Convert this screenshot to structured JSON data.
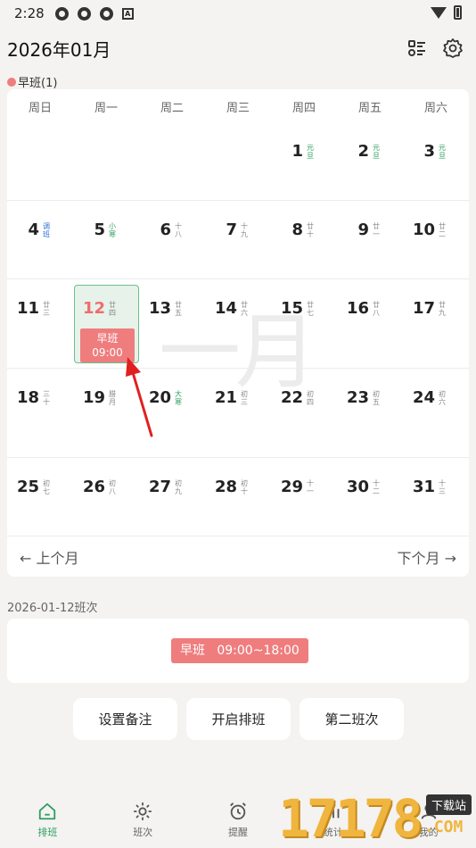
{
  "status_bar": {
    "time": "2:28"
  },
  "header": {
    "title": "2026年01月"
  },
  "legend": {
    "label": "早班(1)",
    "color": "#ef7d7e"
  },
  "calendar": {
    "weekdays": [
      "周日",
      "周一",
      "周二",
      "周三",
      "周四",
      "周五",
      "周六"
    ],
    "watermark": "一月",
    "weeks": [
      [
        null,
        null,
        null,
        null,
        {
          "num": "1",
          "lunar": "元旦",
          "style": "green"
        },
        {
          "num": "2",
          "lunar": "元旦",
          "style": "green"
        },
        {
          "num": "3",
          "lunar": "元旦",
          "style": "green"
        }
      ],
      [
        {
          "num": "4",
          "lunar": "调班",
          "style": "blue"
        },
        {
          "num": "5",
          "lunar": "小寒",
          "style": "green"
        },
        {
          "num": "6",
          "lunar": "十八",
          "style": ""
        },
        {
          "num": "7",
          "lunar": "十九",
          "style": ""
        },
        {
          "num": "8",
          "lunar": "廿十",
          "style": ""
        },
        {
          "num": "9",
          "lunar": "廿一",
          "style": ""
        },
        {
          "num": "10",
          "lunar": "廿二",
          "style": ""
        }
      ],
      [
        {
          "num": "11",
          "lunar": "廿三",
          "style": ""
        },
        {
          "num": "12",
          "lunar": "廿四",
          "style": "",
          "selected": true,
          "shift": "早班",
          "shift_time": "09:00"
        },
        {
          "num": "13",
          "lunar": "廿五",
          "style": ""
        },
        {
          "num": "14",
          "lunar": "廿六",
          "style": ""
        },
        {
          "num": "15",
          "lunar": "廿七",
          "style": ""
        },
        {
          "num": "16",
          "lunar": "廿八",
          "style": ""
        },
        {
          "num": "17",
          "lunar": "廿九",
          "style": ""
        }
      ],
      [
        {
          "num": "18",
          "lunar": "三十",
          "style": ""
        },
        {
          "num": "19",
          "lunar": "腊月",
          "style": ""
        },
        {
          "num": "20",
          "lunar": "大寒",
          "style": "green"
        },
        {
          "num": "21",
          "lunar": "初三",
          "style": ""
        },
        {
          "num": "22",
          "lunar": "初四",
          "style": ""
        },
        {
          "num": "23",
          "lunar": "初五",
          "style": ""
        },
        {
          "num": "24",
          "lunar": "初六",
          "style": ""
        }
      ],
      [
        {
          "num": "25",
          "lunar": "初七",
          "style": ""
        },
        {
          "num": "26",
          "lunar": "初八",
          "style": ""
        },
        {
          "num": "27",
          "lunar": "初九",
          "style": ""
        },
        {
          "num": "28",
          "lunar": "初十",
          "style": ""
        },
        {
          "num": "29",
          "lunar": "十一",
          "style": ""
        },
        {
          "num": "30",
          "lunar": "十二",
          "style": ""
        },
        {
          "num": "31",
          "lunar": "十三",
          "style": ""
        }
      ]
    ],
    "prev_label": "上个月",
    "next_label": "下个月"
  },
  "detail": {
    "title": "2026-01-12班次",
    "badge": "早班   09:00~18:00"
  },
  "actions": {
    "note": "设置备注",
    "schedule": "开启排班",
    "second": "第二班次"
  },
  "bottom_nav": [
    {
      "label": "排班",
      "icon": "home-icon",
      "active": true
    },
    {
      "label": "班次",
      "icon": "sun-icon",
      "active": false
    },
    {
      "label": "提醒",
      "icon": "alarm-icon",
      "active": false
    },
    {
      "label": "统计",
      "icon": "stats-icon",
      "active": false
    },
    {
      "label": "我的",
      "icon": "person-icon",
      "active": false
    }
  ],
  "site_watermark": {
    "digits": "17178",
    "tag": "下载站",
    "com": ".COM"
  },
  "colors": {
    "accent": "#2e9e62",
    "shift": "#ef7d7e",
    "selected_bg": "#e6f2ea"
  }
}
